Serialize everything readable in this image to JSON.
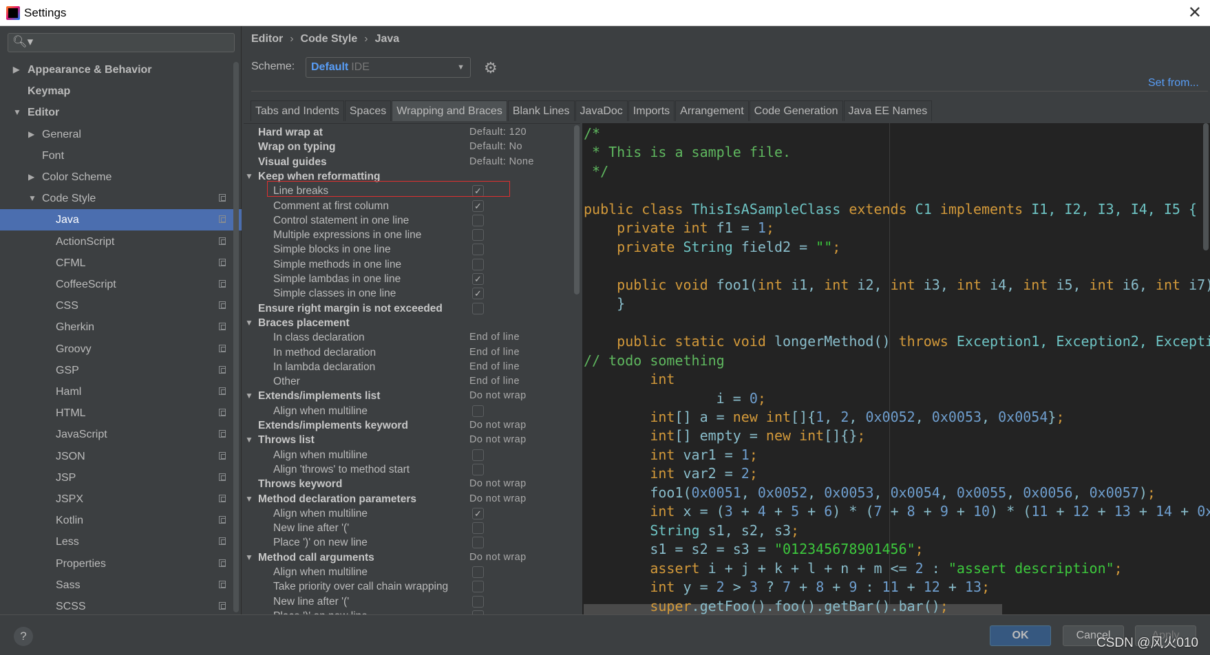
{
  "window": {
    "title": "Settings",
    "close": "✕"
  },
  "search": {
    "icon": "🔍︎▾",
    "placeholder": ""
  },
  "sidebar": {
    "items": [
      {
        "label": "Appearance & Behavior",
        "level": 0,
        "bold": true,
        "arrow": "▶"
      },
      {
        "label": "Keymap",
        "level": 0,
        "bold": true,
        "arrow": ""
      },
      {
        "label": "Editor",
        "level": 0,
        "bold": true,
        "arrow": "▼"
      },
      {
        "label": "General",
        "level": 1,
        "arrow": "▶"
      },
      {
        "label": "Font",
        "level": 1,
        "arrow": ""
      },
      {
        "label": "Color Scheme",
        "level": 1,
        "arrow": "▶"
      },
      {
        "label": "Code Style",
        "level": 1,
        "arrow": "▼",
        "copy": true
      },
      {
        "label": "Java",
        "level": 2,
        "selected": true,
        "copy": true
      },
      {
        "label": "ActionScript",
        "level": 2,
        "copy": true
      },
      {
        "label": "CFML",
        "level": 2,
        "copy": true
      },
      {
        "label": "CoffeeScript",
        "level": 2,
        "copy": true
      },
      {
        "label": "CSS",
        "level": 2,
        "copy": true
      },
      {
        "label": "Gherkin",
        "level": 2,
        "copy": true
      },
      {
        "label": "Groovy",
        "level": 2,
        "copy": true
      },
      {
        "label": "GSP",
        "level": 2,
        "copy": true
      },
      {
        "label": "Haml",
        "level": 2,
        "copy": true
      },
      {
        "label": "HTML",
        "level": 2,
        "copy": true
      },
      {
        "label": "JavaScript",
        "level": 2,
        "copy": true
      },
      {
        "label": "JSON",
        "level": 2,
        "copy": true
      },
      {
        "label": "JSP",
        "level": 2,
        "copy": true
      },
      {
        "label": "JSPX",
        "level": 2,
        "copy": true
      },
      {
        "label": "Kotlin",
        "level": 2,
        "copy": true
      },
      {
        "label": "Less",
        "level": 2,
        "copy": true
      },
      {
        "label": "Properties",
        "level": 2,
        "copy": true
      },
      {
        "label": "Sass",
        "level": 2,
        "copy": true
      },
      {
        "label": "SCSS",
        "level": 2,
        "copy": true
      }
    ]
  },
  "breadcrumb": [
    "Editor",
    "Code Style",
    "Java"
  ],
  "breadcrumb_sep": "›",
  "scheme": {
    "label": "Scheme:",
    "value": "Default",
    "suffix": "IDE"
  },
  "set_from": "Set from...",
  "tabs": [
    {
      "label": "Tabs and Indents"
    },
    {
      "label": "Spaces"
    },
    {
      "label": "Wrapping and Braces",
      "active": true
    },
    {
      "label": "Blank Lines"
    },
    {
      "label": "JavaDoc"
    },
    {
      "label": "Imports"
    },
    {
      "label": "Arrangement"
    },
    {
      "label": "Code Generation"
    },
    {
      "label": "Java EE Names"
    }
  ],
  "options": [
    {
      "label": "Hard wrap at",
      "header": true,
      "value": "Default: 120"
    },
    {
      "label": "Wrap on typing",
      "header": true,
      "value": "Default: No"
    },
    {
      "label": "Visual guides",
      "header": true,
      "value": "Default: None"
    },
    {
      "label": "Keep when reformatting",
      "header": true,
      "expanded": true
    },
    {
      "label": "Line breaks",
      "checked": true,
      "highlighted": true
    },
    {
      "label": "Comment at first column",
      "checked": true
    },
    {
      "label": "Control statement in one line",
      "checked": false
    },
    {
      "label": "Multiple expressions in one line",
      "checked": false
    },
    {
      "label": "Simple blocks in one line",
      "checked": false
    },
    {
      "label": "Simple methods in one line",
      "checked": false
    },
    {
      "label": "Simple lambdas in one line",
      "checked": true
    },
    {
      "label": "Simple classes in one line",
      "checked": true
    },
    {
      "label": "Ensure right margin is not exceeded",
      "header": true,
      "checked": false
    },
    {
      "label": "Braces placement",
      "header": true,
      "expanded": true
    },
    {
      "label": "In class declaration",
      "value": "End of line"
    },
    {
      "label": "In method declaration",
      "value": "End of line"
    },
    {
      "label": "In lambda declaration",
      "value": "End of line"
    },
    {
      "label": "Other",
      "value": "End of line"
    },
    {
      "label": "Extends/implements list",
      "header": true,
      "expanded": true,
      "value": "Do not wrap"
    },
    {
      "label": "Align when multiline",
      "checked": false
    },
    {
      "label": "Extends/implements keyword",
      "header": true,
      "value": "Do not wrap"
    },
    {
      "label": "Throws list",
      "header": true,
      "expanded": true,
      "value": "Do not wrap"
    },
    {
      "label": "Align when multiline",
      "checked": false
    },
    {
      "label": "Align 'throws' to method start",
      "checked": false
    },
    {
      "label": "Throws keyword",
      "header": true,
      "value": "Do not wrap"
    },
    {
      "label": "Method declaration parameters",
      "header": true,
      "expanded": true,
      "value": "Do not wrap"
    },
    {
      "label": "Align when multiline",
      "checked": true
    },
    {
      "label": "New line after '('",
      "checked": false
    },
    {
      "label": "Place ')' on new line",
      "checked": false
    },
    {
      "label": "Method call arguments",
      "header": true,
      "expanded": true,
      "value": "Do not wrap"
    },
    {
      "label": "Align when multiline",
      "checked": false
    },
    {
      "label": "Take priority over call chain wrapping",
      "checked": false
    },
    {
      "label": "New line after '('",
      "checked": false
    },
    {
      "label": "Place ')' on new line",
      "checked": false
    }
  ],
  "code": [
    [
      [
        "m",
        "/*"
      ]
    ],
    [
      [
        "m",
        " * This is a sample file."
      ]
    ],
    [
      [
        "m",
        " */"
      ]
    ],
    [],
    [
      [
        "k",
        "public class "
      ],
      [
        "c",
        "ThisIsASampleClass "
      ],
      [
        "k",
        "extends "
      ],
      [
        "c",
        "C1 "
      ],
      [
        "k",
        "implements "
      ],
      [
        "c",
        "I1, I2, I3, I4, I5 {"
      ]
    ],
    [
      [
        "i",
        "    "
      ],
      [
        "k",
        "private int "
      ],
      [
        "i",
        "f1 = "
      ],
      [
        "n",
        "1"
      ],
      [
        "k",
        ";"
      ]
    ],
    [
      [
        "i",
        "    "
      ],
      [
        "k",
        "private "
      ],
      [
        "c",
        "String "
      ],
      [
        "i",
        "field2 = "
      ],
      [
        "s",
        "\"\""
      ],
      [
        "k",
        ";"
      ]
    ],
    [],
    [
      [
        "i",
        "    "
      ],
      [
        "k",
        "public void "
      ],
      [
        "i",
        "foo1("
      ],
      [
        "k",
        "int "
      ],
      [
        "i",
        "i1, "
      ],
      [
        "k",
        "int "
      ],
      [
        "i",
        "i2, "
      ],
      [
        "k",
        "int "
      ],
      [
        "i",
        "i3, "
      ],
      [
        "k",
        "int "
      ],
      [
        "i",
        "i4, "
      ],
      [
        "k",
        "int "
      ],
      [
        "i",
        "i5, "
      ],
      [
        "k",
        "int "
      ],
      [
        "i",
        "i6, "
      ],
      [
        "k",
        "int "
      ],
      [
        "i",
        "i7)"
      ]
    ],
    [
      [
        "i",
        "    }"
      ]
    ],
    [],
    [
      [
        "i",
        "    "
      ],
      [
        "k",
        "public static void "
      ],
      [
        "i",
        "longerMethod() "
      ],
      [
        "k",
        "throws "
      ],
      [
        "c",
        "Exception1, Exception2, Excepti"
      ]
    ],
    [
      [
        "m",
        "// todo something"
      ]
    ],
    [
      [
        "i",
        "        "
      ],
      [
        "k",
        "int"
      ]
    ],
    [
      [
        "i",
        "                i = "
      ],
      [
        "n",
        "0"
      ],
      [
        "k",
        ";"
      ]
    ],
    [
      [
        "i",
        "        "
      ],
      [
        "k",
        "int"
      ],
      [
        "i",
        "[] a = "
      ],
      [
        "k",
        "new int"
      ],
      [
        "i",
        "[]{"
      ],
      [
        "n",
        "1"
      ],
      [
        "i",
        ", "
      ],
      [
        "n",
        "2"
      ],
      [
        "i",
        ", "
      ],
      [
        "n",
        "0x0052"
      ],
      [
        "i",
        ", "
      ],
      [
        "n",
        "0x0053"
      ],
      [
        "i",
        ", "
      ],
      [
        "n",
        "0x0054"
      ],
      [
        "i",
        "}"
      ],
      [
        "k",
        ";"
      ]
    ],
    [
      [
        "i",
        "        "
      ],
      [
        "k",
        "int"
      ],
      [
        "i",
        "[] empty = "
      ],
      [
        "k",
        "new int"
      ],
      [
        "i",
        "[]{}"
      ],
      [
        "k",
        ";"
      ]
    ],
    [
      [
        "i",
        "        "
      ],
      [
        "k",
        "int "
      ],
      [
        "i",
        "var1 = "
      ],
      [
        "n",
        "1"
      ],
      [
        "k",
        ";"
      ]
    ],
    [
      [
        "i",
        "        "
      ],
      [
        "k",
        "int "
      ],
      [
        "i",
        "var2 = "
      ],
      [
        "n",
        "2"
      ],
      [
        "k",
        ";"
      ]
    ],
    [
      [
        "i",
        "        foo1("
      ],
      [
        "n",
        "0x0051"
      ],
      [
        "i",
        ", "
      ],
      [
        "n",
        "0x0052"
      ],
      [
        "i",
        ", "
      ],
      [
        "n",
        "0x0053"
      ],
      [
        "i",
        ", "
      ],
      [
        "n",
        "0x0054"
      ],
      [
        "i",
        ", "
      ],
      [
        "n",
        "0x0055"
      ],
      [
        "i",
        ", "
      ],
      [
        "n",
        "0x0056"
      ],
      [
        "i",
        ", "
      ],
      [
        "n",
        "0x0057"
      ],
      [
        "i",
        ")"
      ],
      [
        "k",
        ";"
      ]
    ],
    [
      [
        "i",
        "        "
      ],
      [
        "k",
        "int "
      ],
      [
        "i",
        "x = ("
      ],
      [
        "n",
        "3"
      ],
      [
        "i",
        " + "
      ],
      [
        "n",
        "4"
      ],
      [
        "i",
        " + "
      ],
      [
        "n",
        "5"
      ],
      [
        "i",
        " + "
      ],
      [
        "n",
        "6"
      ],
      [
        "i",
        ") * ("
      ],
      [
        "n",
        "7"
      ],
      [
        "i",
        " + "
      ],
      [
        "n",
        "8"
      ],
      [
        "i",
        " + "
      ],
      [
        "n",
        "9"
      ],
      [
        "i",
        " + "
      ],
      [
        "n",
        "10"
      ],
      [
        "i",
        ") * ("
      ],
      [
        "n",
        "11"
      ],
      [
        "i",
        " + "
      ],
      [
        "n",
        "12"
      ],
      [
        "i",
        " + "
      ],
      [
        "n",
        "13"
      ],
      [
        "i",
        " + "
      ],
      [
        "n",
        "14"
      ],
      [
        "i",
        " + "
      ],
      [
        "n",
        "0x"
      ]
    ],
    [
      [
        "i",
        "        "
      ],
      [
        "c",
        "String "
      ],
      [
        "i",
        "s1, s2, s3"
      ],
      [
        "k",
        ";"
      ]
    ],
    [
      [
        "i",
        "        s1 = s2 = s3 = "
      ],
      [
        "s",
        "\"012345678901456\""
      ],
      [
        "k",
        ";"
      ]
    ],
    [
      [
        "i",
        "        "
      ],
      [
        "k",
        "assert "
      ],
      [
        "i",
        "i + j + k + l + n + m <= "
      ],
      [
        "n",
        "2"
      ],
      [
        "i",
        " : "
      ],
      [
        "s",
        "\"assert description\""
      ],
      [
        "k",
        ";"
      ]
    ],
    [
      [
        "i",
        "        "
      ],
      [
        "k",
        "int "
      ],
      [
        "i",
        "y = "
      ],
      [
        "n",
        "2"
      ],
      [
        "i",
        " > "
      ],
      [
        "n",
        "3"
      ],
      [
        "i",
        " ? "
      ],
      [
        "n",
        "7"
      ],
      [
        "i",
        " + "
      ],
      [
        "n",
        "8"
      ],
      [
        "i",
        " + "
      ],
      [
        "n",
        "9"
      ],
      [
        "i",
        " : "
      ],
      [
        "n",
        "11"
      ],
      [
        "i",
        " + "
      ],
      [
        "n",
        "12"
      ],
      [
        "i",
        " + "
      ],
      [
        "n",
        "13"
      ],
      [
        "k",
        ";"
      ]
    ],
    [
      [
        "i",
        "        "
      ],
      [
        "k",
        "super"
      ],
      [
        "i",
        ".getFoo().foo().getBar().bar()"
      ],
      [
        "k",
        ";"
      ]
    ]
  ],
  "footer": {
    "help": "?",
    "ok": "OK",
    "cancel": "Cancel",
    "apply": "Apply"
  },
  "watermark": "CSDN @风火010",
  "colors": {
    "selection": "#4b6eaf",
    "accent": "#589df6",
    "ok_button": "#365880",
    "highlight_box": "#e03030"
  }
}
